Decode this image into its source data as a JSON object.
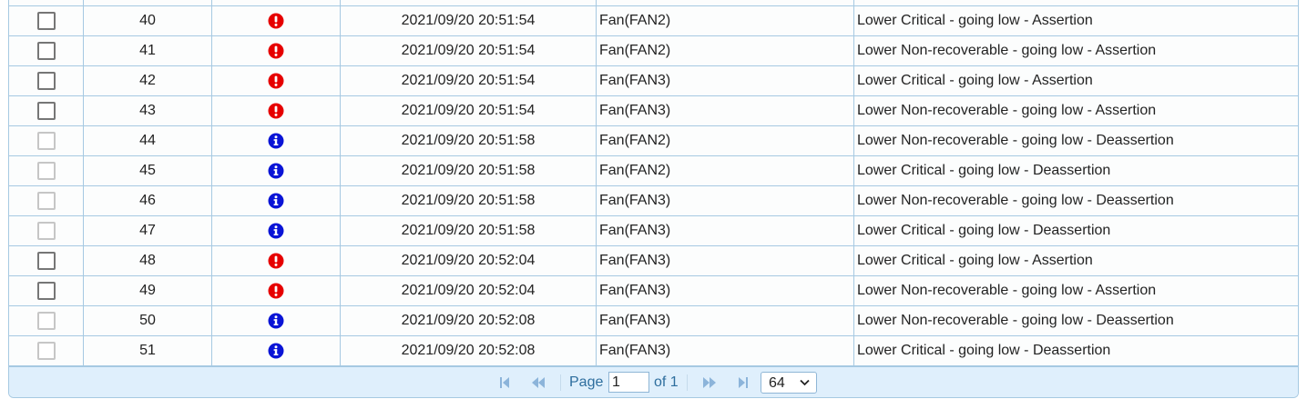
{
  "rows": [
    {
      "id": "40",
      "severity": "critical",
      "time": "2021/09/20 20:51:54",
      "sensor": "Fan(FAN2)",
      "description": "Lower Critical - going low - Assertion"
    },
    {
      "id": "41",
      "severity": "critical",
      "time": "2021/09/20 20:51:54",
      "sensor": "Fan(FAN2)",
      "description": "Lower Non-recoverable - going low - Assertion"
    },
    {
      "id": "42",
      "severity": "critical",
      "time": "2021/09/20 20:51:54",
      "sensor": "Fan(FAN3)",
      "description": "Lower Critical - going low - Assertion"
    },
    {
      "id": "43",
      "severity": "critical",
      "time": "2021/09/20 20:51:54",
      "sensor": "Fan(FAN3)",
      "description": "Lower Non-recoverable - going low - Assertion"
    },
    {
      "id": "44",
      "severity": "info",
      "time": "2021/09/20 20:51:58",
      "sensor": "Fan(FAN2)",
      "description": "Lower Non-recoverable - going low - Deassertion"
    },
    {
      "id": "45",
      "severity": "info",
      "time": "2021/09/20 20:51:58",
      "sensor": "Fan(FAN2)",
      "description": "Lower Critical - going low - Deassertion"
    },
    {
      "id": "46",
      "severity": "info",
      "time": "2021/09/20 20:51:58",
      "sensor": "Fan(FAN3)",
      "description": "Lower Non-recoverable - going low - Deassertion"
    },
    {
      "id": "47",
      "severity": "info",
      "time": "2021/09/20 20:51:58",
      "sensor": "Fan(FAN3)",
      "description": "Lower Critical - going low - Deassertion"
    },
    {
      "id": "48",
      "severity": "critical",
      "time": "2021/09/20 20:52:04",
      "sensor": "Fan(FAN3)",
      "description": "Lower Critical - going low - Assertion"
    },
    {
      "id": "49",
      "severity": "critical",
      "time": "2021/09/20 20:52:04",
      "sensor": "Fan(FAN3)",
      "description": "Lower Non-recoverable - going low - Assertion"
    },
    {
      "id": "50",
      "severity": "info",
      "time": "2021/09/20 20:52:08",
      "sensor": "Fan(FAN3)",
      "description": "Lower Non-recoverable - going low - Deassertion"
    },
    {
      "id": "51",
      "severity": "info",
      "time": "2021/09/20 20:52:08",
      "sensor": "Fan(FAN3)",
      "description": "Lower Critical - going low - Deassertion"
    }
  ],
  "pager": {
    "page_label": "Page",
    "page_value": "1",
    "of_label": "of 1",
    "page_size": "64"
  },
  "icons": {
    "critical": "exclamation-circle-icon",
    "info": "info-circle-icon",
    "first": "first-page-icon",
    "prev": "previous-page-icon",
    "next": "next-page-icon",
    "last": "last-page-icon"
  },
  "colors": {
    "critical": "#e60000",
    "info": "#0a14d6",
    "border": "#a6c9e2",
    "pager_bg": "#dfeffc",
    "pager_text": "#2e6e9e"
  }
}
